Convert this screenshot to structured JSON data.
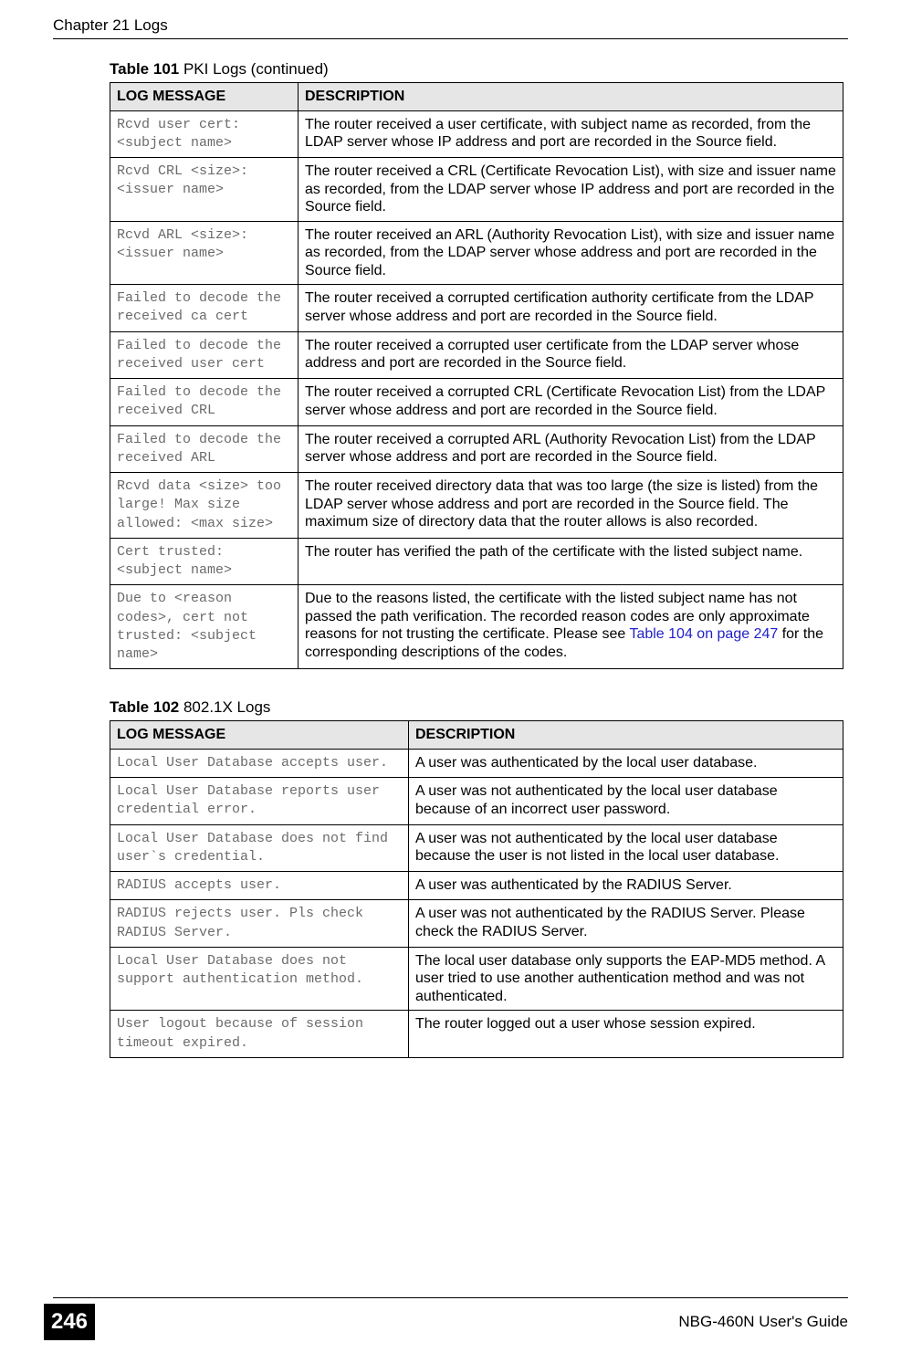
{
  "header": {
    "chapter": "Chapter 21 Logs"
  },
  "footer": {
    "page": "246",
    "guide": "NBG-460N User's Guide"
  },
  "table101": {
    "caption_bold": "Table 101",
    "caption_rest": "   PKI Logs (continued)",
    "headers": {
      "col1": "LOG MESSAGE",
      "col2": "DESCRIPTION"
    },
    "rows": [
      {
        "msg": "Rcvd user cert: <subject name>",
        "desc": "The router received a user certificate, with subject name as recorded, from the LDAP server whose IP address and port are recorded in the Source field."
      },
      {
        "msg": "Rcvd CRL <size>: <issuer name>",
        "desc": "The router received a CRL (Certificate Revocation List), with size and issuer name as recorded, from the LDAP server whose IP address and port are recorded in the Source field."
      },
      {
        "msg": "Rcvd ARL <size>: <issuer name>",
        "desc": "The router received an ARL (Authority Revocation List), with size and issuer name as recorded, from the LDAP server whose address and port are recorded in the Source field."
      },
      {
        "msg": "Failed to decode the received ca cert",
        "desc": "The router received a corrupted certification authority certificate from the LDAP server whose address and port are recorded in the Source field."
      },
      {
        "msg": "Failed to decode the received user cert",
        "desc": "The router received a corrupted user certificate from the LDAP server whose address and port are recorded in the Source field."
      },
      {
        "msg": "Failed to decode the received CRL",
        "desc": "The router received a corrupted CRL (Certificate Revocation List) from the LDAP server whose address and port are recorded in the Source field."
      },
      {
        "msg": "Failed to decode the received ARL",
        "desc": "The router received a corrupted ARL (Authority Revocation List) from the LDAP server whose address and port are recorded in the Source field."
      },
      {
        "msg": "Rcvd data <size> too large! Max size allowed: <max size>",
        "desc": "The router received directory data that was too large (the size is listed) from the LDAP server whose address and port are recorded in the Source field. The maximum size of directory data that the router allows is also recorded."
      },
      {
        "msg": "Cert trusted: <subject name>",
        "desc": "The router has verified the path of the certificate with the listed subject name."
      },
      {
        "msg": "Due to <reason codes>, cert not trusted: <subject name>",
        "desc_pre": "Due to the reasons listed, the certificate with the listed subject name has not passed the path verification. The recorded reason codes are only approximate reasons for not trusting the certificate. Please see ",
        "link": "Table 104 on page 247",
        "desc_post": " for the corresponding descriptions of the codes."
      }
    ]
  },
  "table102": {
    "caption_bold": "Table 102",
    "caption_rest": "   802.1X Logs",
    "headers": {
      "col1": "LOG MESSAGE",
      "col2": "DESCRIPTION"
    },
    "rows": [
      {
        "msg": "Local User Database accepts user.",
        "desc": "A user was authenticated by the local user database."
      },
      {
        "msg": "Local User Database reports user credential error.",
        "desc": "A user was not authenticated by the local user database because of an incorrect user password."
      },
      {
        "msg": "Local User Database does not find user`s credential.",
        "desc": "A user was not authenticated by the local user database because the user is not listed in the local user database."
      },
      {
        "msg": "RADIUS accepts user.",
        "desc": "A user was authenticated by the RADIUS Server."
      },
      {
        "msg": "RADIUS rejects user. Pls check RADIUS Server.",
        "desc": "A user was not authenticated by the RADIUS Server. Please check the RADIUS Server."
      },
      {
        "msg": "Local User Database does not support authentication method.",
        "desc": "The local user database only supports the EAP-MD5 method. A user tried to use another authentication method and was not authenticated."
      },
      {
        "msg": "User logout because of session timeout expired.",
        "desc": "The router logged out a user whose session expired."
      }
    ]
  }
}
